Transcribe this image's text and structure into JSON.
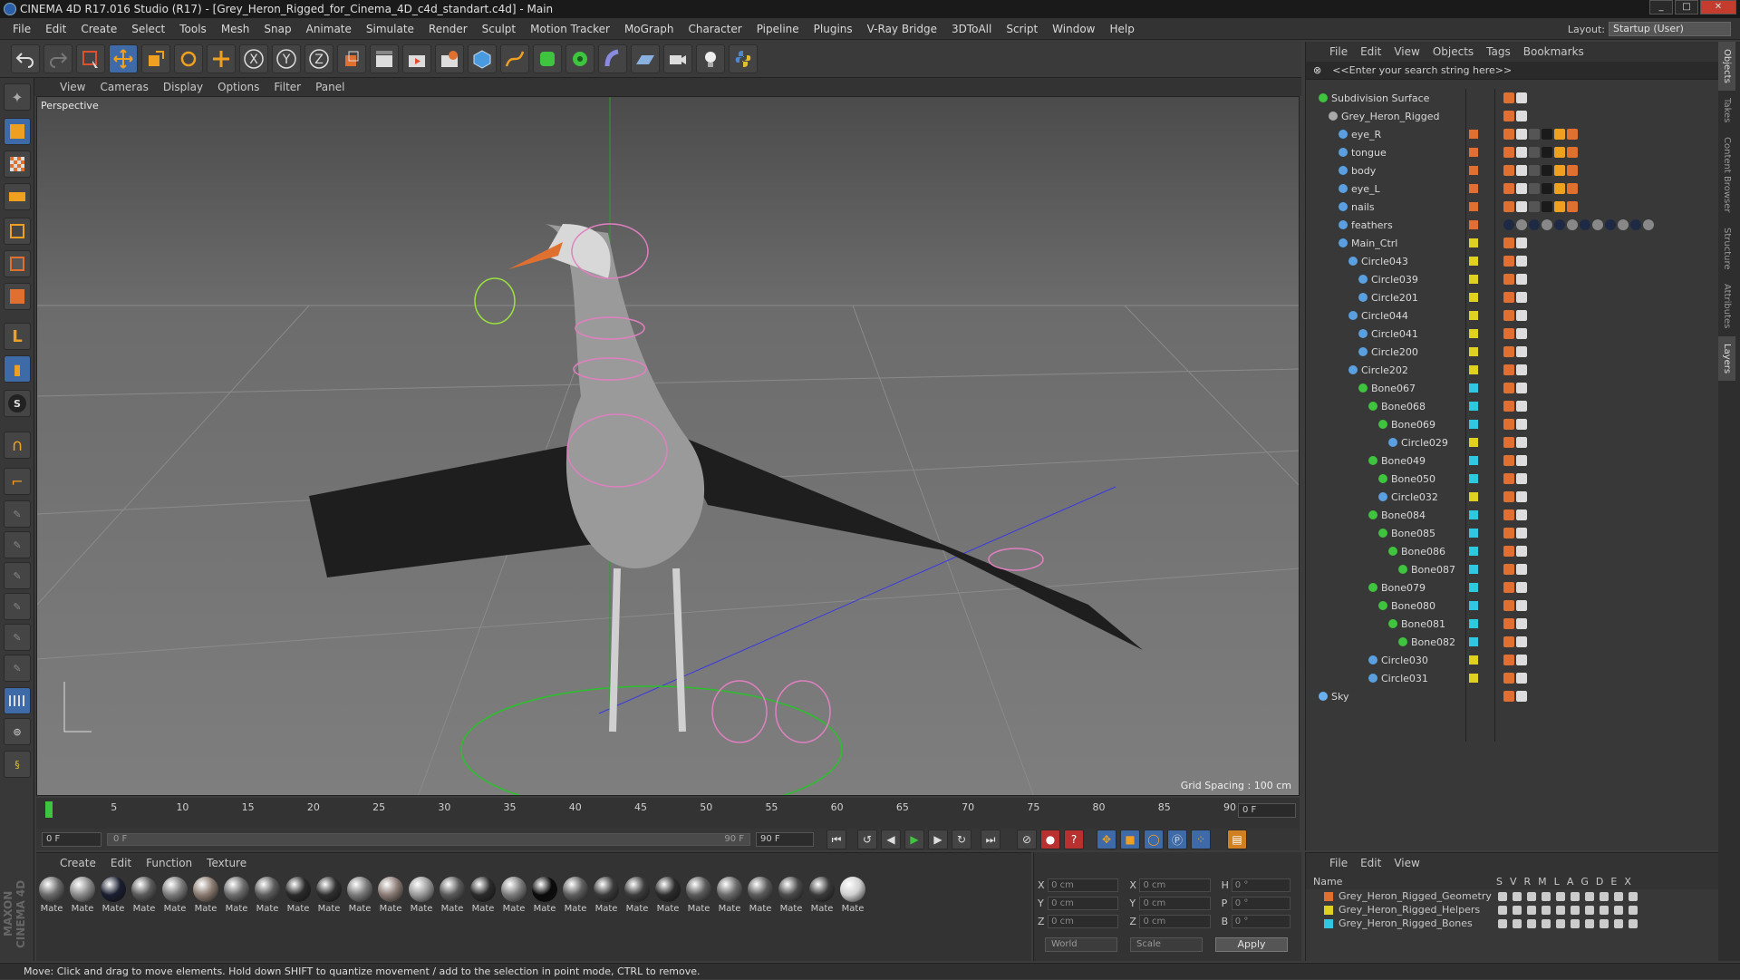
{
  "window": {
    "title": "CINEMA 4D R17.016 Studio (R17) - [Grey_Heron_Rigged_for_Cinema_4D_c4d_standart.c4d] - Main",
    "minimize": "_",
    "maximize": "□",
    "close": "✕"
  },
  "menu": [
    "File",
    "Edit",
    "Create",
    "Select",
    "Tools",
    "Mesh",
    "Snap",
    "Animate",
    "Simulate",
    "Render",
    "Sculpt",
    "Motion Tracker",
    "MoGraph",
    "Character",
    "Pipeline",
    "Plugins",
    "V-Ray Bridge",
    "3DToAll",
    "Script",
    "Window",
    "Help"
  ],
  "layout": {
    "label": "Layout:",
    "value": "Startup (User)"
  },
  "viewport": {
    "menu": [
      "View",
      "Cameras",
      "Display",
      "Options",
      "Filter",
      "Panel"
    ],
    "label": "Perspective",
    "grid_spacing": "Grid Spacing : 100 cm"
  },
  "timeline": {
    "ticks": [
      "0",
      "5",
      "10",
      "15",
      "20",
      "25",
      "30",
      "35",
      "40",
      "45",
      "50",
      "55",
      "60",
      "65",
      "70",
      "75",
      "80",
      "85",
      "90"
    ],
    "current_frame": "0 F",
    "start": "0 F",
    "range_start": "0 F",
    "range_end": "90 F",
    "end": "90 F"
  },
  "materials": {
    "menu": [
      "Create",
      "Edit",
      "Function",
      "Texture"
    ],
    "label": "Mate",
    "colors": [
      "#6a6a6a",
      "#8a8a8a",
      "#1a1e30",
      "#5a5a5a",
      "#7a7a7a",
      "#8a7a70",
      "#6c6c6c",
      "#5c5c5c",
      "#2a2a2a",
      "#2e2e2e",
      "#7a7a7a",
      "#8a7a74",
      "#9a9a9a",
      "#5a5a5a",
      "#2a2a2a",
      "#7c7c7c",
      "#0a0a0a",
      "#5e5e5e",
      "#3a3a3a",
      "#3c3c3c",
      "#2c2c2c",
      "#5a5a5a",
      "#6a6a6a",
      "#5a5a5a",
      "#4a4a4a",
      "#3a3a3a",
      "#cfcfcf"
    ]
  },
  "coords": {
    "x": "0 cm",
    "y": "0 cm",
    "z": "0 cm",
    "sx": "0 cm",
    "sy": "0 cm",
    "sz": "0 cm",
    "h": "0 °",
    "p": "0 °",
    "b": "0 °",
    "world": "World",
    "scale": "Scale",
    "apply": "Apply"
  },
  "objects": {
    "menu": [
      "File",
      "Edit",
      "View",
      "Objects",
      "Tags",
      "Bookmarks"
    ],
    "search_placeholder": "<<Enter your search string here>>",
    "tree": [
      {
        "name": "Subdivision Surface",
        "depth": 0,
        "color": "none",
        "icon": "#3ec43e"
      },
      {
        "name": "Grey_Heron_Rigged",
        "depth": 1,
        "color": "none",
        "icon": "#aaaaaa"
      },
      {
        "name": "eye_R",
        "depth": 2,
        "color": "#e07030",
        "icon": "#5aa0e0"
      },
      {
        "name": "tongue",
        "depth": 2,
        "color": "#e07030",
        "icon": "#5aa0e0"
      },
      {
        "name": "body",
        "depth": 2,
        "color": "#e07030",
        "icon": "#5aa0e0"
      },
      {
        "name": "eye_L",
        "depth": 2,
        "color": "#e07030",
        "icon": "#5aa0e0"
      },
      {
        "name": "nails",
        "depth": 2,
        "color": "#e07030",
        "icon": "#5aa0e0"
      },
      {
        "name": "feathers",
        "depth": 2,
        "color": "#e07030",
        "icon": "#5aa0e0"
      },
      {
        "name": "Main_Ctrl",
        "depth": 2,
        "color": "#e0d020",
        "icon": "#5aa0e0"
      },
      {
        "name": "Circle043",
        "depth": 3,
        "color": "#e0d020",
        "icon": "#5aa0e0"
      },
      {
        "name": "Circle039",
        "depth": 4,
        "color": "#e0d020",
        "icon": "#5aa0e0"
      },
      {
        "name": "Circle201",
        "depth": 4,
        "color": "#e0d020",
        "icon": "#5aa0e0"
      },
      {
        "name": "Circle044",
        "depth": 3,
        "color": "#e0d020",
        "icon": "#5aa0e0"
      },
      {
        "name": "Circle041",
        "depth": 4,
        "color": "#e0d020",
        "icon": "#5aa0e0"
      },
      {
        "name": "Circle200",
        "depth": 4,
        "color": "#e0d020",
        "icon": "#5aa0e0"
      },
      {
        "name": "Circle202",
        "depth": 3,
        "color": "#e0d020",
        "icon": "#5aa0e0"
      },
      {
        "name": "Bone067",
        "depth": 4,
        "color": "#30c8e0",
        "icon": "#3ec43e"
      },
      {
        "name": "Bone068",
        "depth": 5,
        "color": "#30c8e0",
        "icon": "#3ec43e"
      },
      {
        "name": "Bone069",
        "depth": 6,
        "color": "#30c8e0",
        "icon": "#3ec43e"
      },
      {
        "name": "Circle029",
        "depth": 7,
        "color": "#e0d020",
        "icon": "#5aa0e0"
      },
      {
        "name": "Bone049",
        "depth": 5,
        "color": "#30c8e0",
        "icon": "#3ec43e"
      },
      {
        "name": "Bone050",
        "depth": 6,
        "color": "#30c8e0",
        "icon": "#3ec43e"
      },
      {
        "name": "Circle032",
        "depth": 6,
        "color": "#e0d020",
        "icon": "#5aa0e0"
      },
      {
        "name": "Bone084",
        "depth": 5,
        "color": "#30c8e0",
        "icon": "#3ec43e"
      },
      {
        "name": "Bone085",
        "depth": 6,
        "color": "#30c8e0",
        "icon": "#3ec43e"
      },
      {
        "name": "Bone086",
        "depth": 7,
        "color": "#30c8e0",
        "icon": "#3ec43e"
      },
      {
        "name": "Bone087",
        "depth": 8,
        "color": "#30c8e0",
        "icon": "#3ec43e"
      },
      {
        "name": "Bone079",
        "depth": 5,
        "color": "#30c8e0",
        "icon": "#3ec43e"
      },
      {
        "name": "Bone080",
        "depth": 6,
        "color": "#30c8e0",
        "icon": "#3ec43e"
      },
      {
        "name": "Bone081",
        "depth": 7,
        "color": "#30c8e0",
        "icon": "#3ec43e"
      },
      {
        "name": "Bone082",
        "depth": 8,
        "color": "#30c8e0",
        "icon": "#3ec43e"
      },
      {
        "name": "Circle030",
        "depth": 5,
        "color": "#e0d020",
        "icon": "#5aa0e0"
      },
      {
        "name": "Circle031",
        "depth": 5,
        "color": "#e0d020",
        "icon": "#5aa0e0"
      },
      {
        "name": "Sky",
        "depth": 0,
        "color": "none",
        "icon": "#6ab0f0"
      }
    ]
  },
  "layers": {
    "menu": [
      "File",
      "Edit",
      "View"
    ],
    "name_header": "Name",
    "columns": [
      "S",
      "V",
      "R",
      "M",
      "L",
      "A",
      "G",
      "D",
      "E",
      "X"
    ],
    "items": [
      {
        "name": "Grey_Heron_Rigged_Geometry",
        "color": "#e07030"
      },
      {
        "name": "Grey_Heron_Rigged_Helpers",
        "color": "#e0d020"
      },
      {
        "name": "Grey_Heron_Rigged_Bones",
        "color": "#30c8e0"
      }
    ]
  },
  "side_tabs": [
    "Objects",
    "Takes",
    "Content Browser",
    "Structure",
    "Attributes",
    "Layers"
  ],
  "status": "Move: Click and drag to move elements. Hold down SHIFT to quantize movement / add to the selection in point mode, CTRL to remove.",
  "brand": "MAXON CINEMA 4D"
}
